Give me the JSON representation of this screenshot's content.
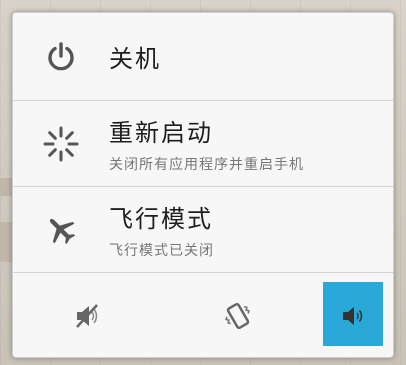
{
  "colors": {
    "accent": "#2aa8d8",
    "icon": "#555555",
    "dialog_bg": "#f7f7f7"
  },
  "menu": {
    "items": [
      {
        "icon": "power-icon",
        "title": "关机",
        "subtitle": ""
      },
      {
        "icon": "restart-spinner-icon",
        "title": "重新启动",
        "subtitle": "关闭所有应用程序并重启手机"
      },
      {
        "icon": "airplane-icon",
        "title": "飞行模式",
        "subtitle": "飞行模式已关闭"
      }
    ]
  },
  "sound_modes": [
    {
      "icon": "sound-muted-icon",
      "selected": false
    },
    {
      "icon": "vibrate-icon",
      "selected": false
    },
    {
      "icon": "sound-on-icon",
      "selected": true
    }
  ]
}
